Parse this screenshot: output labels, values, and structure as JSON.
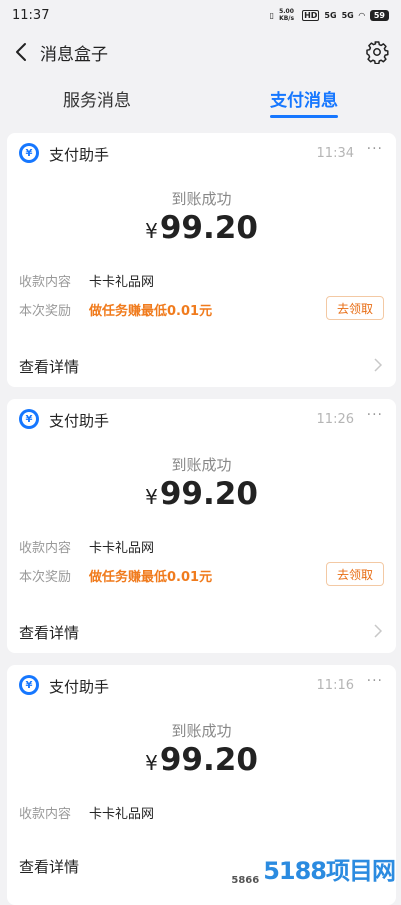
{
  "status": {
    "time": "11:37",
    "net_speed": "5.00 KB/s",
    "hd": "HD",
    "sig1": "5G",
    "sig2": "5G",
    "battery": "59"
  },
  "header": {
    "title": "消息盒子"
  },
  "tabs": [
    {
      "label": "服务消息",
      "active": false
    },
    {
      "label": "支付消息",
      "active": true
    }
  ],
  "cards": [
    {
      "app_name": "支付助手",
      "time": "11:34",
      "status": "到账成功",
      "currency": "¥",
      "amount": "99.20",
      "rows": [
        {
          "label": "收款内容",
          "value": "卡卡礼品网"
        },
        {
          "label": "本次奖励",
          "value": "做任务赚最低0.01元"
        }
      ],
      "claim": "去领取",
      "detail": "查看详情"
    },
    {
      "app_name": "支付助手",
      "time": "11:26",
      "status": "到账成功",
      "currency": "¥",
      "amount": "99.20",
      "rows": [
        {
          "label": "收款内容",
          "value": "卡卡礼品网"
        },
        {
          "label": "本次奖励",
          "value": "做任务赚最低0.01元"
        }
      ],
      "claim": "去领取",
      "detail": "查看详情"
    },
    {
      "app_name": "支付助手",
      "time": "11:16",
      "status": "到账成功",
      "currency": "¥",
      "amount": "99.20",
      "rows": [
        {
          "label": "收款内容",
          "value": "卡卡礼品网"
        }
      ],
      "detail": "查看详情"
    }
  ],
  "watermark": {
    "small": "5866",
    "big": "5188项目网"
  },
  "colors": {
    "accent": "#1677ff",
    "reward": "#f07b1d"
  }
}
